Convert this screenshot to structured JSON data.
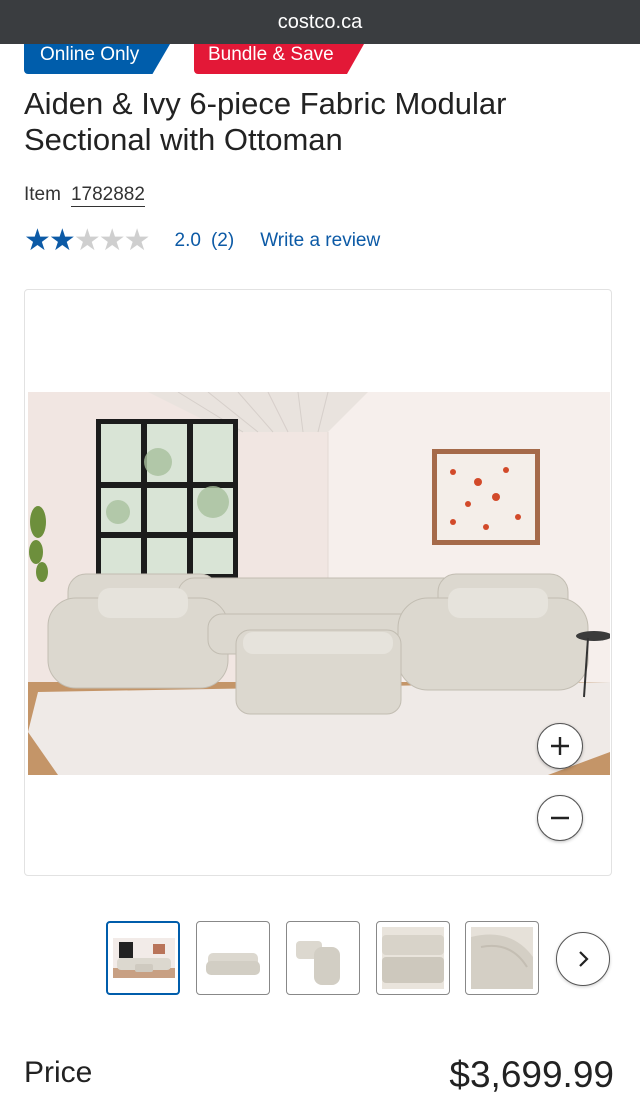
{
  "browser": {
    "url": "costco.ca"
  },
  "badges": {
    "online_only": "Online Only",
    "bundle_save": "Bundle & Save"
  },
  "product": {
    "title": "Aiden & Ivy 6-piece Fabric Modular Sectional with Ottoman",
    "item_label": "Item",
    "item_number": "1782882",
    "rating": {
      "stars_filled": 2,
      "stars_total": 5,
      "value": "2.0",
      "count": "(2)"
    },
    "write_review": "Write a review"
  },
  "gallery": {
    "zoom_in_icon": "plus-icon",
    "zoom_out_icon": "minus-icon",
    "thumbnails": [
      "room-view",
      "front-view",
      "corner-piece",
      "cushion-detail",
      "armrest-detail"
    ],
    "next_icon": "chevron-right-icon"
  },
  "price": {
    "label": "Price",
    "value": "$3,699.99"
  },
  "colors": {
    "brand_blue": "#005dab",
    "brand_red": "#e31837",
    "link_blue": "#0c5aa6"
  }
}
